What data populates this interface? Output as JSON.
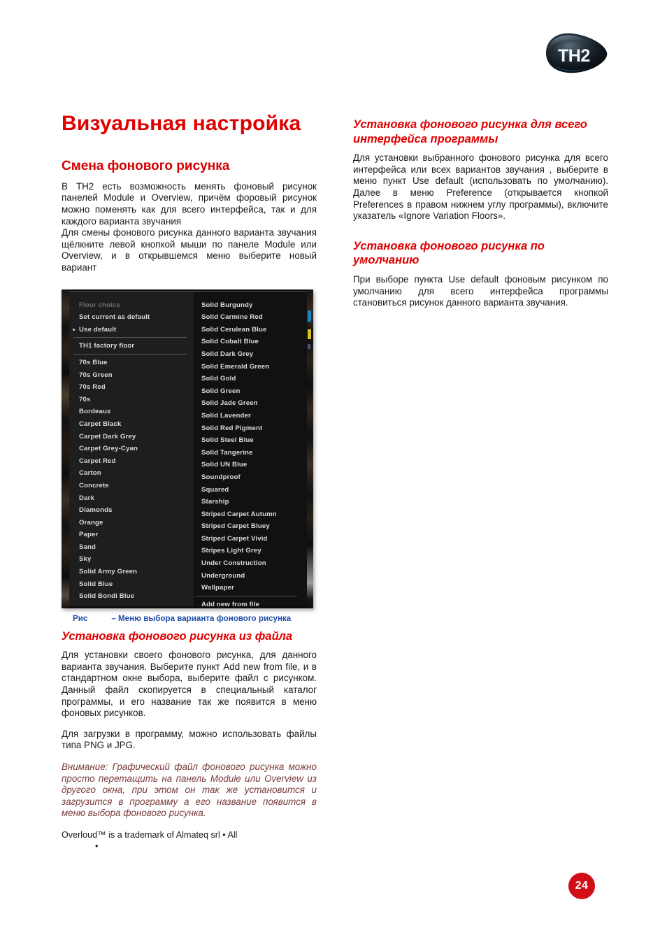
{
  "document": {
    "logo_text": "TH2",
    "page_number": "24"
  },
  "left_column": {
    "title": "Визуальная настройка",
    "section_title": "Смена фонового рисунка",
    "paragraph_1": "В TH2 есть возможность менять фоновый рисунок панелей Module и Overview, причём форовый рисунок можно поменять как для всего интерфейса, так и для каждого варианта звучания",
    "paragraph_2": "Для смены фонового рисунка данного варианта звучания  щёлкните левой кнопкой мыши по панеле Module или Overview, и  в открывшемся меню выберите новый вариант",
    "figure_caption_label": "Рис",
    "figure_caption_text": "– Меню выбора варианта фонового рисунка",
    "subheading_file": "Установка фонового рисунка из файла",
    "paragraph_3": "Для установки своего фонового рисунка, для данного варианта звучания. Выберите пункт Add new from file, и в стандартном окне выбора, выберите файл с рисунком. Данный файл скопируется в специальный каталог программы, и его название так же появится в меню фоновых рисунков.",
    "paragraph_4": "Для загрузки в программу, можно использовать файлы типа PNG и JPG.",
    "note": "Внимание: Графический файл фонового рисунка можно просто перетащить на панель Module или Overview из другого окна, при этом он так же установится и загрузится в программу а его название  появится в меню выбора фонового рисунка.",
    "trademark": "Overloud™ is a trademark of Almateq srl • All",
    "trademark_bullet": "•"
  },
  "right_column": {
    "subheading_interface": "Установка фонового рисунка для всего интерфейса программы",
    "paragraph_1": "Для установки выбранного фонового рисунка для всего интерфейса  или всех вариантов звучания , выберите в меню пункт Use default (использовать по умолчанию). Далее в меню Preference (открывается кнопкой Preferences в правом нижнем углу программы), включите указатель «Ignore Variation Floors».",
    "subheading_default": "Установка фонового рисунка по умолчанию",
    "paragraph_2": "При выборе пункта Use default  фоновым рисунком по умолчанию  для всего интерфейса программы становиться рисунок данного варианта звучания."
  },
  "figure_menu": {
    "left_items": [
      {
        "label": "Floor choice",
        "style": "dim"
      },
      {
        "label": "Set current as default",
        "style": "normal"
      },
      {
        "label": "Use default",
        "style": "bulleted sep-below"
      },
      {
        "label": "TH1 factory floor",
        "style": "gap-top sep-below"
      },
      {
        "label": "70s Blue",
        "style": "gap-top"
      },
      {
        "label": "70s Green",
        "style": "normal"
      },
      {
        "label": "70s Red",
        "style": "normal"
      },
      {
        "label": "70s",
        "style": "normal"
      },
      {
        "label": "Bordeaux",
        "style": "normal"
      },
      {
        "label": "Carpet Black",
        "style": "normal"
      },
      {
        "label": "Carpet Dark Grey",
        "style": "normal"
      },
      {
        "label": "Carpet Grey-Cyan",
        "style": "normal"
      },
      {
        "label": "Carpet Red",
        "style": "normal"
      },
      {
        "label": "Carton",
        "style": "normal"
      },
      {
        "label": "Concrete",
        "style": "normal"
      },
      {
        "label": "Dark",
        "style": "normal"
      },
      {
        "label": "Diamonds",
        "style": "normal"
      },
      {
        "label": "Orange",
        "style": "normal"
      },
      {
        "label": "Paper",
        "style": "normal"
      },
      {
        "label": "Sand",
        "style": "normal"
      },
      {
        "label": "Sky",
        "style": "normal"
      },
      {
        "label": "Solid Army Green",
        "style": "normal"
      },
      {
        "label": "Solid Blue",
        "style": "normal"
      },
      {
        "label": "Solid Bondi Blue",
        "style": "normal"
      }
    ],
    "right_items": [
      {
        "label": "Solid Burgundy",
        "style": "normal"
      },
      {
        "label": "Solid Carmine Red",
        "style": "normal"
      },
      {
        "label": "Solid Cerulean Blue",
        "style": "normal"
      },
      {
        "label": "Solid Cobalt Blue",
        "style": "normal"
      },
      {
        "label": "Solid Dark Grey",
        "style": "normal"
      },
      {
        "label": "Solid Emerald Green",
        "style": "normal"
      },
      {
        "label": "Solid Gold",
        "style": "normal"
      },
      {
        "label": "Solid Green",
        "style": "normal"
      },
      {
        "label": "Solid Jade Green",
        "style": "normal"
      },
      {
        "label": "Solid Lavender",
        "style": "normal"
      },
      {
        "label": "Solid Red Pigment",
        "style": "normal"
      },
      {
        "label": "Solid Steel Blue",
        "style": "normal"
      },
      {
        "label": "Solid Tangerine",
        "style": "normal"
      },
      {
        "label": "Solid UN Blue",
        "style": "normal"
      },
      {
        "label": "Soundproof",
        "style": "normal"
      },
      {
        "label": "Squared",
        "style": "normal"
      },
      {
        "label": "Starship",
        "style": "normal"
      },
      {
        "label": "Striped Carpet Autumn",
        "style": "normal"
      },
      {
        "label": "Striped Carpet Bluey",
        "style": "normal"
      },
      {
        "label": "Striped Carpet Vivid",
        "style": "normal"
      },
      {
        "label": "Stripes Light Grey",
        "style": "normal"
      },
      {
        "label": "Under Construction",
        "style": "normal"
      },
      {
        "label": "Underground",
        "style": "normal"
      },
      {
        "label": "Wallpaper",
        "style": "normal"
      },
      {
        "label": "Add new from file",
        "style": "gap-top sep-above"
      }
    ]
  },
  "colors": {
    "title_red": "#e00000",
    "section_red": "#d60000",
    "caption_blue": "#1f4fa8",
    "note_maroon": "#7a3b3b",
    "badge_red": "#d10d18"
  }
}
